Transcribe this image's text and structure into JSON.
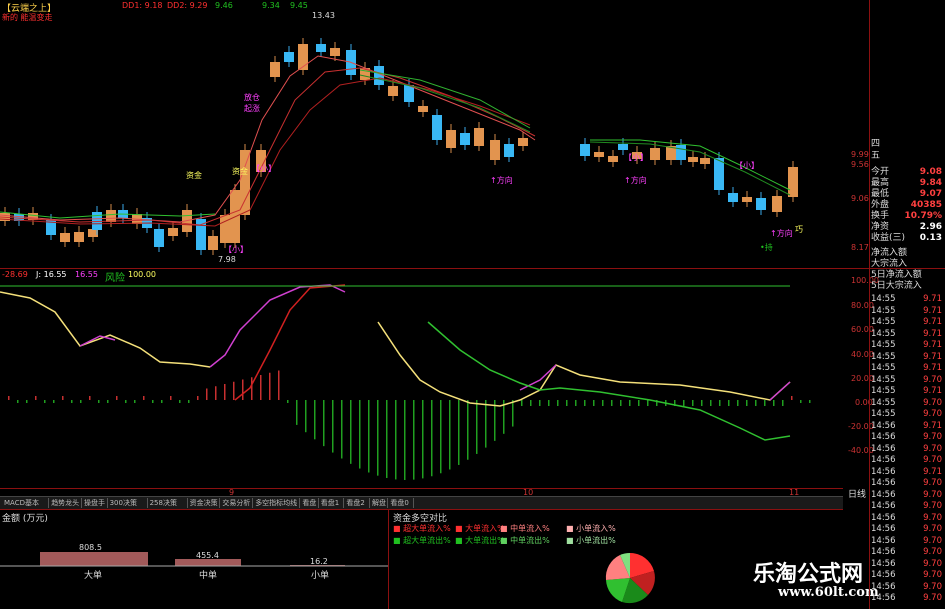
{
  "header": {
    "title": "【云端之上】",
    "subtitle": "新的 能温变走",
    "indicators": [
      {
        "text": "DD1: 9.18",
        "color": "#ff3030"
      },
      {
        "text": "DD2: 9.29",
        "color": "#ff3030"
      },
      {
        "text": "9.46",
        "color": "#20c020"
      },
      {
        "text": "9.34",
        "color": "#20c020"
      },
      {
        "text": "9.45",
        "color": "#20c020"
      }
    ],
    "high_label": "13.43"
  },
  "main_annotations": {
    "zi_jin_1": "资金",
    "zi_jin_2": "资金",
    "fang_cang": "放仓",
    "fang_xiang": "放向",
    "qi_zhang": "起涨",
    "low_label": "7.98",
    "xiaoying_1": "【小】",
    "xiaoying_2": "【小】",
    "xiaoying_3": "【小】",
    "xiaoying_4": "【小】",
    "wei_1": "↑方向",
    "wei_2": "↑方向",
    "wei_3": "↑方向",
    "qiao": "巧",
    "zhi": "•持"
  },
  "price_axis": {
    "labels": [
      "9.99",
      "9.56",
      "9.06",
      "8.17"
    ]
  },
  "kdj": {
    "legend": [
      {
        "text": "-28.69",
        "color": "#ff3030"
      },
      {
        "text": "J: 16.55",
        "color": "#ffffff"
      },
      {
        "text": "16.55",
        "color": "#ff40ff"
      },
      {
        "text": "风险",
        "color": "#20c020"
      },
      {
        "text": "100.00",
        "color": "#ffff60"
      }
    ],
    "axis_labels": [
      "100.00",
      "80.00",
      "60.00",
      "40.00",
      "20.00",
      "0.00",
      "-20.00",
      "-40.00"
    ]
  },
  "date_labels": [
    "9",
    "10",
    "11"
  ],
  "day_line_tab": "日线",
  "tabs": [
    "MACD基本",
    "趋势龙头",
    "操盘手",
    "300决策",
    "258决策",
    "资金决策",
    "交易分析",
    "多空指标均线",
    "看盘",
    "看盘1",
    "看盘2",
    "解盘",
    "看盘0"
  ],
  "bottom_left": {
    "title": "金额 (万元)",
    "bars": [
      {
        "label": "大单",
        "value": "808.5"
      },
      {
        "label": "中单",
        "value": "455.4"
      },
      {
        "label": "小单",
        "value": "16.2"
      }
    ]
  },
  "bottom_mid": {
    "title": "资金多空对比",
    "row1": [
      "■ 超大单流入% ",
      "■ 大单流入%",
      "■ 中单流入%",
      "■ 小单流入%"
    ],
    "row2": [
      "■ 超大单流出% ",
      "■ 大单流出%",
      "■ 中单流出%",
      "■ 小单流出%"
    ]
  },
  "watermark": {
    "title": "乐淘公式网",
    "url": "www.60lt.com"
  },
  "right_panel": {
    "bid_ask": [
      {
        "label": "四",
        "value": ""
      },
      {
        "label": "五",
        "value": ""
      }
    ],
    "stats": [
      {
        "label": "今开",
        "value": "9.08"
      },
      {
        "label": "最高",
        "value": "9.84"
      },
      {
        "label": "最低",
        "value": "9.07"
      },
      {
        "label": "外盘",
        "value": "40385"
      },
      {
        "label": "换手",
        "value": "10.79%"
      },
      {
        "label": "净资",
        "value": "2.96"
      },
      {
        "label": "收益(三)",
        "value": "0.13"
      }
    ],
    "flows": [
      "净流入额",
      "大宗流入",
      "5日净流入额",
      "5日大宗流入"
    ],
    "trades": [
      {
        "time": "14:55",
        "price": "9.71"
      },
      {
        "time": "14:55",
        "price": "9.71"
      },
      {
        "time": "14:55",
        "price": "9.71"
      },
      {
        "time": "14:55",
        "price": "9.71"
      },
      {
        "time": "14:55",
        "price": "9.71"
      },
      {
        "time": "14:55",
        "price": "9.71"
      },
      {
        "time": "14:55",
        "price": "9.71"
      },
      {
        "time": "14:55",
        "price": "9.70"
      },
      {
        "time": "14:55",
        "price": "9.71"
      },
      {
        "time": "14:55",
        "price": "9.70"
      },
      {
        "time": "14:55",
        "price": "9.70"
      },
      {
        "time": "14:56",
        "price": "9.71"
      },
      {
        "time": "14:56",
        "price": "9.70"
      },
      {
        "time": "14:56",
        "price": "9.70"
      },
      {
        "time": "14:56",
        "price": "9.70"
      },
      {
        "time": "14:56",
        "price": "9.71"
      },
      {
        "time": "14:56",
        "price": "9.70"
      },
      {
        "time": "14:56",
        "price": "9.70"
      },
      {
        "time": "14:56",
        "price": "9.70"
      },
      {
        "time": "14:56",
        "price": "9.70"
      },
      {
        "time": "14:56",
        "price": "9.70"
      },
      {
        "time": "14:56",
        "price": "9.70"
      },
      {
        "time": "14:56",
        "price": "9.70"
      },
      {
        "time": "14:56",
        "price": "9.70"
      },
      {
        "time": "14:56",
        "price": "9.70"
      },
      {
        "time": "14:56",
        "price": "9.70"
      },
      {
        "time": "14:56",
        "price": "9.70"
      }
    ]
  }
}
